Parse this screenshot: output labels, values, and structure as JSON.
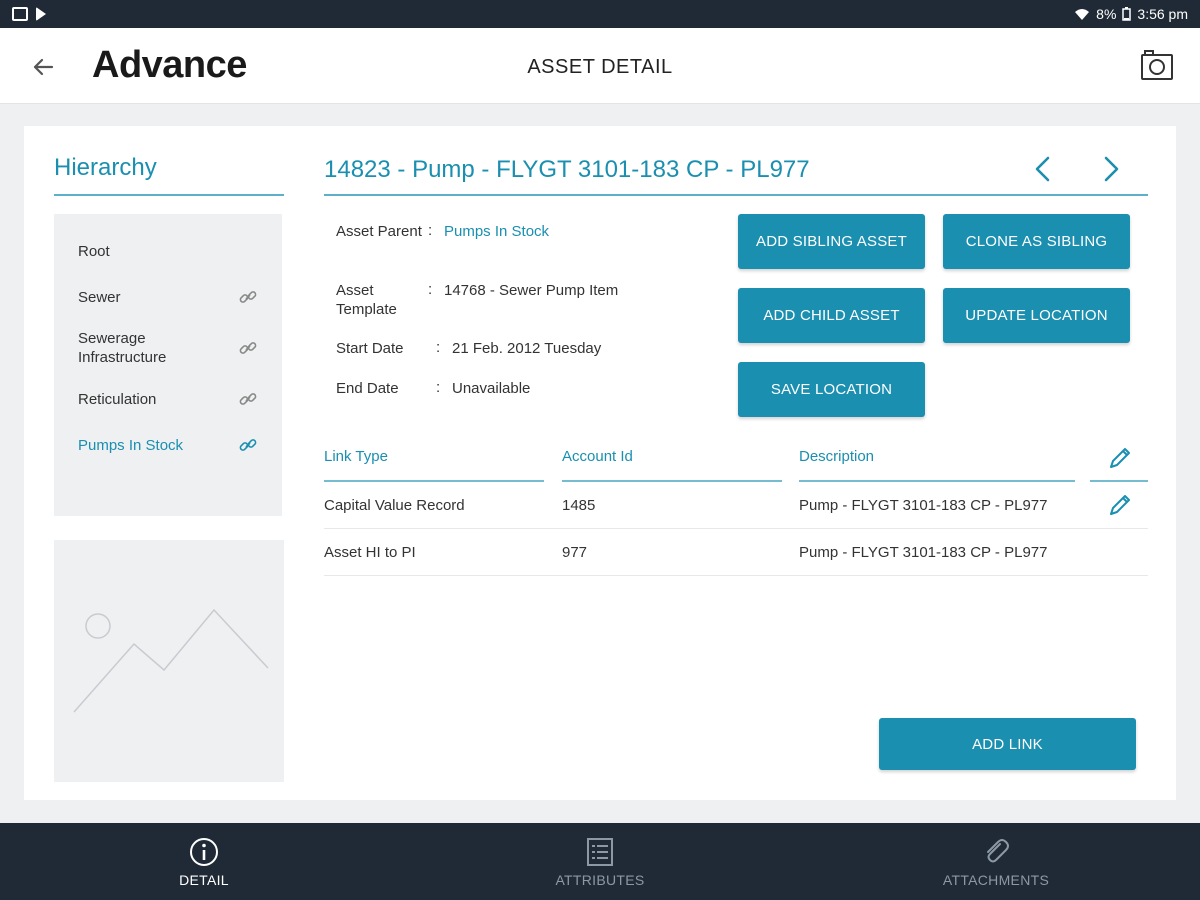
{
  "status_bar": {
    "battery": "8%",
    "time": "3:56 pm"
  },
  "header": {
    "logo": "Advance",
    "title": "ASSET DETAIL"
  },
  "sidebar": {
    "title": "Hierarchy",
    "items": [
      {
        "label": "Root",
        "linked": false,
        "active": false
      },
      {
        "label": "Sewer",
        "linked": true,
        "active": false
      },
      {
        "label": "Sewerage Infrastructure",
        "linked": true,
        "active": false
      },
      {
        "label": "Reticulation",
        "linked": true,
        "active": false
      },
      {
        "label": "Pumps In Stock",
        "linked": true,
        "active": true
      }
    ]
  },
  "asset": {
    "title": "14823 - Pump - FLYGT 3101-183 CP - PL977",
    "details": [
      {
        "label": "Asset Parent",
        "value": "Pumps In Stock",
        "is_link": true
      },
      {
        "label": "Asset Template",
        "value": "14768 - Sewer Pump Item",
        "is_link": false
      },
      {
        "label": "Start Date",
        "value": "21 Feb. 2012 Tuesday",
        "is_link": false
      },
      {
        "label": "End Date",
        "value": "Unavailable",
        "is_link": false
      }
    ]
  },
  "actions": {
    "add_sibling": "ADD SIBLING ASSET",
    "clone_sibling": "CLONE AS SIBLING",
    "add_child": "ADD CHILD ASSET",
    "update_location": "UPDATE LOCATION",
    "save_location": "SAVE LOCATION"
  },
  "links_table": {
    "columns": [
      "Link Type",
      "Account Id",
      "Description"
    ],
    "rows": [
      {
        "link_type": "Capital Value Record",
        "account_id": "1485",
        "description": "Pump - FLYGT 3101-183 CP - PL977",
        "editable": true
      },
      {
        "link_type": "Asset HI to PI",
        "account_id": "977",
        "description": "Pump - FLYGT 3101-183 CP - PL977",
        "editable": false
      }
    ],
    "add_label": "ADD LINK"
  },
  "bottom_nav": {
    "tabs": [
      {
        "label": "DETAIL",
        "icon": "info-icon",
        "active": true
      },
      {
        "label": "ATTRIBUTES",
        "icon": "list-icon",
        "active": false
      },
      {
        "label": "ATTACHMENTS",
        "icon": "paperclip-icon",
        "active": false
      }
    ]
  },
  "colors": {
    "accent": "#1a8fb0",
    "nav_bg": "#1f2a36",
    "panel_bg": "#eef0f2"
  }
}
